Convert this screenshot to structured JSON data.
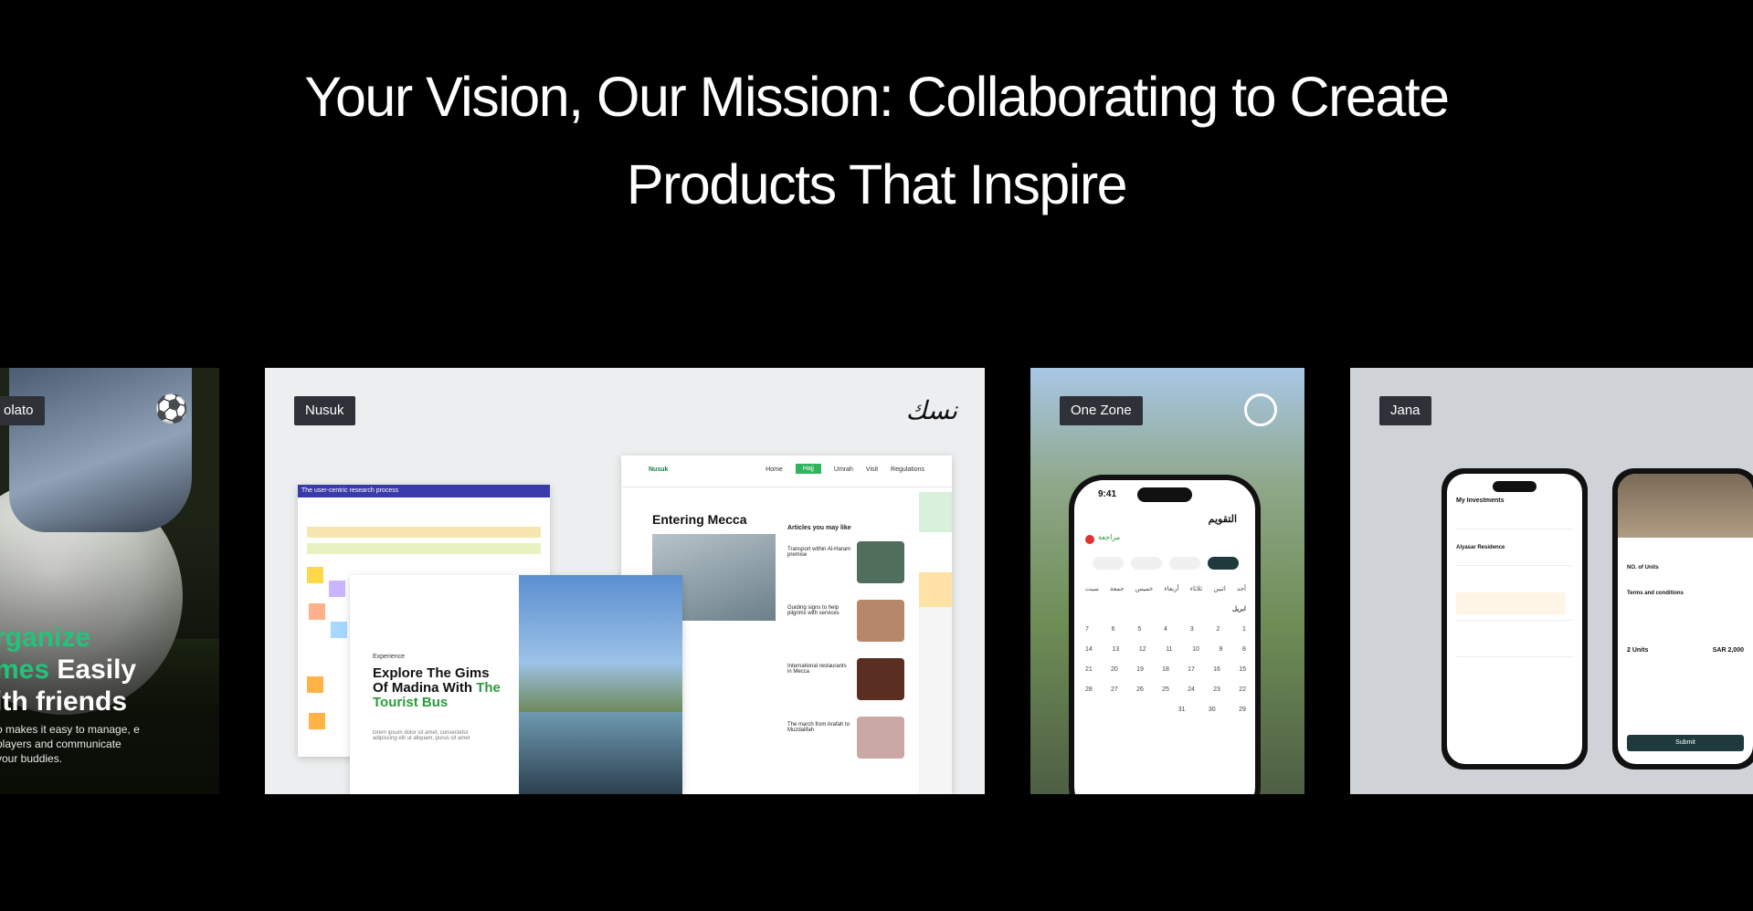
{
  "headline": {
    "line1": "Your Vision, Our Mission: Collaborating to Create",
    "line2": "Products That Inspire"
  },
  "cards": [
    {
      "tag": "olato",
      "promo": {
        "line1a": "rganize",
        "line2a": "mes",
        "line2b": " Easily",
        "line3": "ith friends",
        "body": "o makes it easy to manage, e players and communicate your buddies."
      },
      "accent": "#22c37a"
    },
    {
      "tag": "Nusuk",
      "site": {
        "logo": "Nusuk",
        "nav": [
          "Home",
          "Hajj",
          "Umrah",
          "Visit",
          "Regulations"
        ],
        "heading": "Entering Mecca",
        "articles_title": "Articles you may like",
        "articles": [
          "Transport within Al-Haram premise",
          "Guiding signs to help pilgrims with services",
          "International restaurants in Mecca",
          "The march from Arafah to Muzdalifah"
        ]
      },
      "board": {
        "title": "The user-centric research process"
      },
      "promo": {
        "caption": "Experience",
        "title_a": "Explore The Gims Of Madina With ",
        "title_b": "The Tourist Bus",
        "desc": "lorem ipsum dolor sit amet, consectetur adipiscing elit ut aliquam, purus sit amet"
      },
      "accent": "#2c9a3c"
    },
    {
      "tag": "One Zone",
      "phone": {
        "time": "9:41",
        "title": "التقويم",
        "review": "مراجعة",
        "month": "ابريل",
        "weekdays": [
          "أحد",
          "اثنين",
          "ثلاثاء",
          "أربعاء",
          "خميس",
          "جمعة",
          "سبت"
        ],
        "weeks": [
          [
            "7",
            "6",
            "5",
            "4",
            "3",
            "2",
            "1"
          ],
          [
            "14",
            "13",
            "12",
            "11",
            "10",
            "9",
            "8"
          ],
          [
            "21",
            "20",
            "19",
            "18",
            "17",
            "16",
            "15"
          ],
          [
            "28",
            "27",
            "26",
            "25",
            "24",
            "23",
            "22"
          ],
          [
            "",
            "",
            "",
            "",
            "31",
            "30",
            "29"
          ]
        ]
      }
    },
    {
      "tag": "Jana",
      "phone1": {
        "title": "My Investments",
        "residence": "Alyasar Residence"
      },
      "phone2": {
        "units_label": "NO. of Units",
        "terms": "Terms and conditions",
        "submit": "Submit",
        "units": "2 Units",
        "price": "SAR 2,000"
      }
    }
  ]
}
